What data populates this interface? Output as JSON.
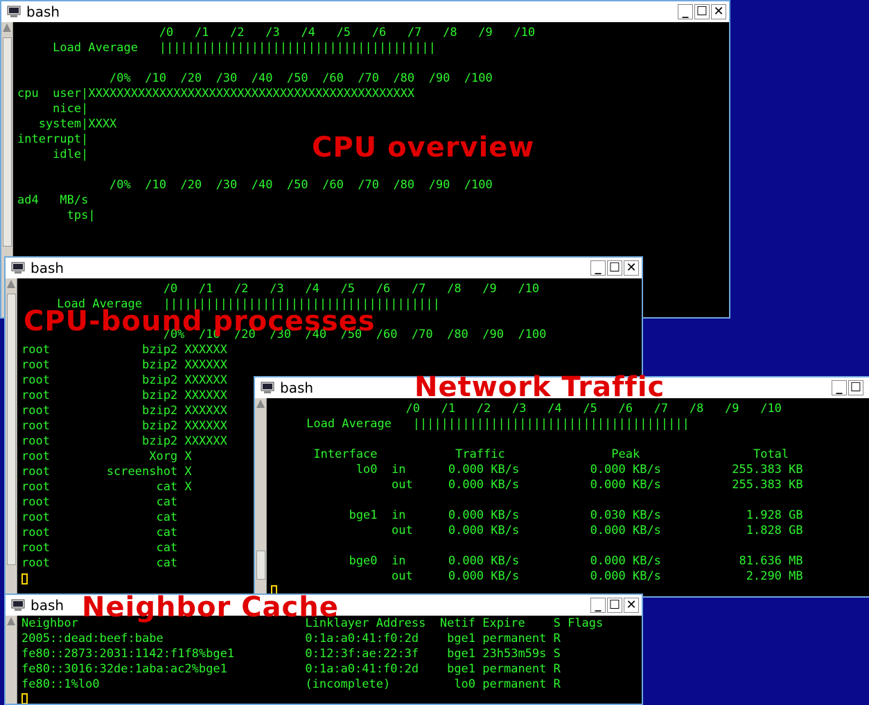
{
  "colors": {
    "desktop": "#0a0a8c",
    "terminal_bg": "#000000",
    "terminal_text": "#2ef52e",
    "overlay": "#e00000",
    "border": "#6fa8dc",
    "cursor": "#ffd400"
  },
  "icons": {
    "terminal": "terminal-icon",
    "minimize": "minimize-icon",
    "maximize": "maximize-icon",
    "close": "close-icon"
  },
  "window_buttons": {
    "minimize": "_",
    "maximize": "☐",
    "close": "✕"
  },
  "overlays": {
    "cpu_overview": "CPU overview",
    "cpu_bound": "CPU-bound processes",
    "network": "Network Traffic",
    "neighbor": "Neighbor Cache"
  },
  "win1": {
    "title": "bash",
    "lines": [
      "                    /0   /1   /2   /3   /4   /5   /6   /7   /8   /9   /10",
      "     Load Average   |||||||||||||||||||||||||||||||||||||||",
      "",
      "             /0%  /10  /20  /30  /40  /50  /60  /70  /80  /90  /100",
      "cpu  user|XXXXXXXXXXXXXXXXXXXXXXXXXXXXXXXXXXXXXXXXXXXXXX",
      "     nice|",
      "   system|XXXX",
      "interrupt|",
      "     idle|",
      "",
      "             /0%  /10  /20  /30  /40  /50  /60  /70  /80  /90  /100",
      "ad4   MB/s",
      "       tps|"
    ]
  },
  "win2": {
    "title": "bash",
    "lines": [
      "                    /0   /1   /2   /3   /4   /5   /6   /7   /8   /9   /10",
      "     Load Average   |||||||||||||||||||||||||||||||||||||||",
      "",
      "                    /0%  /10  /20  /30  /40  /50  /60  /70  /80  /90  /100",
      "root             bzip2 XXXXXX",
      "root             bzip2 XXXXXX",
      "root             bzip2 XXXXXX",
      "root             bzip2 XXXXXX",
      "root             bzip2 XXXXXX",
      "root             bzip2 XXXXXX",
      "root             bzip2 XXXXXX",
      "root              Xorg X",
      "root        screenshot X",
      "root               cat X",
      "root               cat",
      "root               cat",
      "root               cat",
      "root               cat",
      "root               cat"
    ]
  },
  "win3": {
    "title": "bash",
    "lines": [
      "                   /0   /1   /2   /3   /4   /5   /6   /7   /8   /9   /10",
      "     Load Average   |||||||||||||||||||||||||||||||||||||||",
      "",
      "      Interface           Traffic               Peak                Total",
      "            lo0  in      0.000 KB/s          0.000 KB/s          255.383 KB",
      "                 out     0.000 KB/s          0.000 KB/s          255.383 KB",
      "",
      "           bge1  in      0.000 KB/s          0.030 KB/s            1.928 GB",
      "                 out     0.000 KB/s          0.000 KB/s            1.828 GB",
      "",
      "           bge0  in      0.000 KB/s          0.000 KB/s           81.636 MB",
      "                 out     0.000 KB/s          0.000 KB/s            2.290 MB"
    ]
  },
  "win4": {
    "title": "bash",
    "lines": [
      "Neighbor                                Linklayer Address  Netif Expire    S Flags",
      "2005::dead:beef:babe                    0:1a:a0:41:f0:2d    bge1 permanent R",
      "fe80::2873:2031:1142:f1f8%bge1          0:12:3f:ae:22:3f    bge1 23h53m59s S",
      "fe80::3016:32de:1aba:ac2%bge1           0:1a:a0:41:f0:2d    bge1 permanent R",
      "fe80::1%lo0                             (incomplete)         lo0 permanent R"
    ]
  }
}
